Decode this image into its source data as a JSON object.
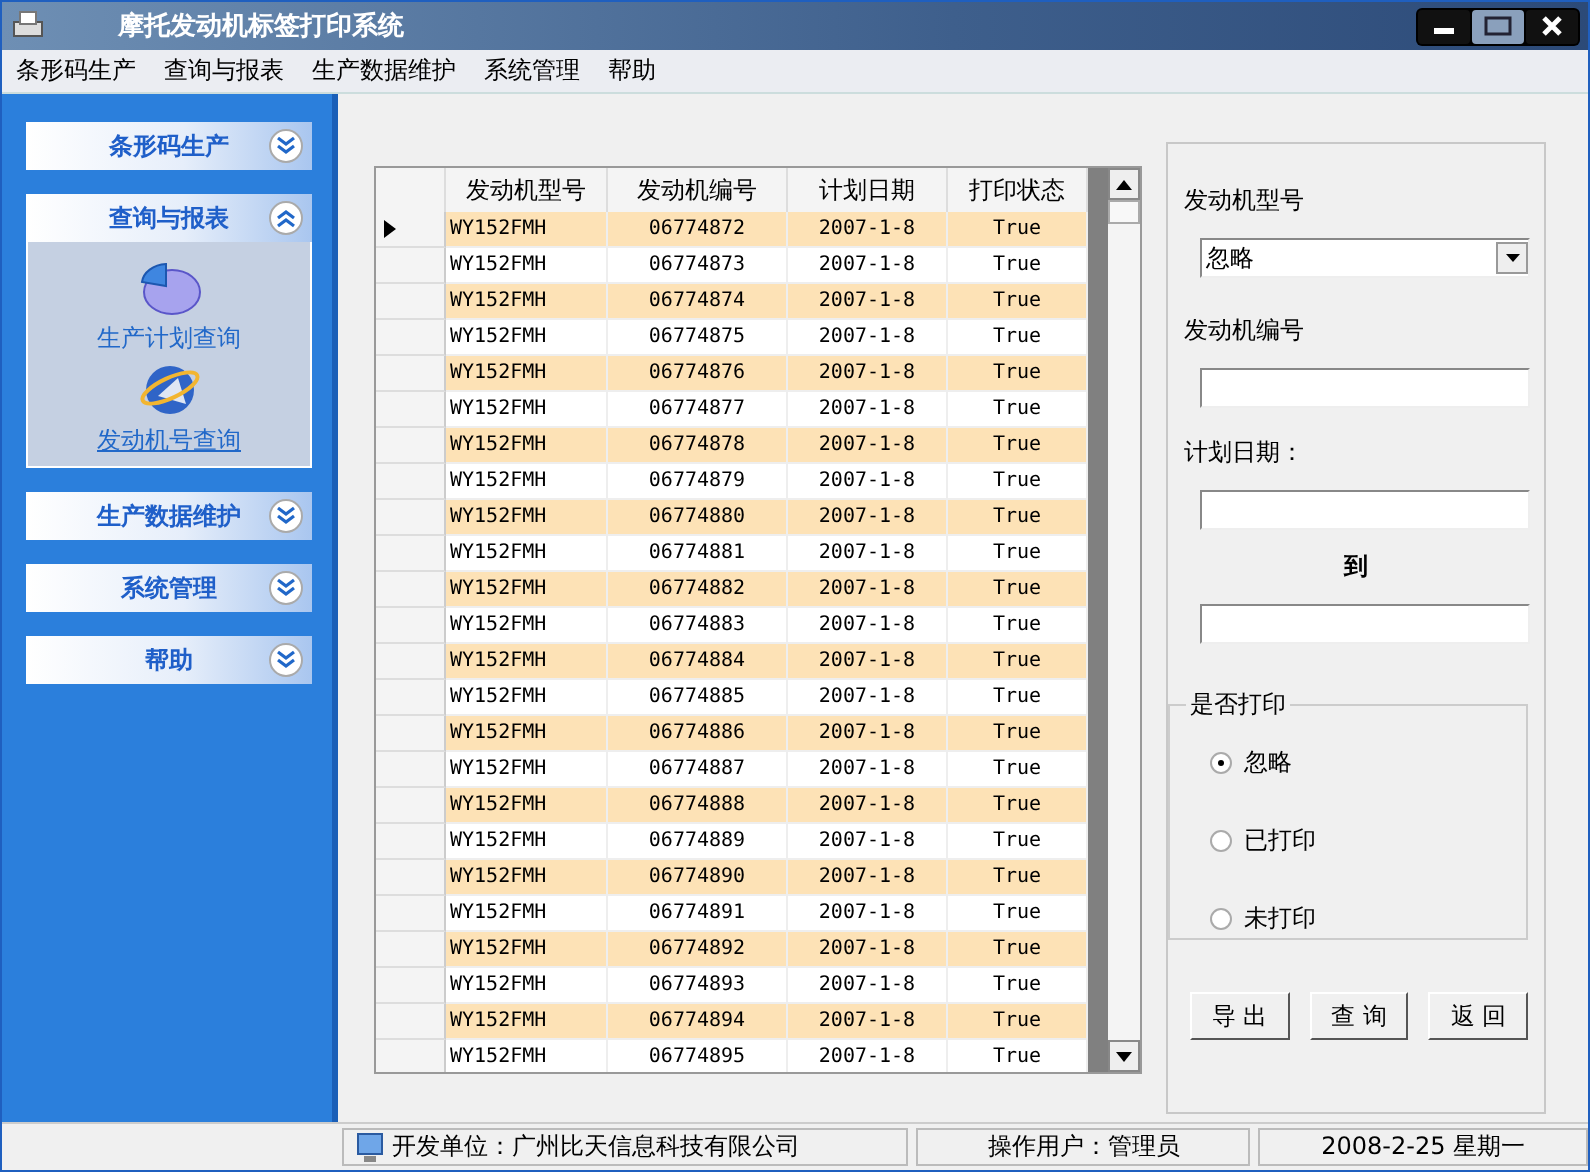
{
  "window": {
    "title": "摩托发动机标签打印系统"
  },
  "menu": [
    "条形码生产",
    "查询与报表",
    "生产数据维护",
    "系统管理",
    "帮助"
  ],
  "sidebar": {
    "groups": [
      {
        "label": "条形码生产",
        "expanded": false
      },
      {
        "label": "查询与报表",
        "expanded": true,
        "items": [
          {
            "label": "生产计划查询",
            "kind": "chart",
            "selected": false
          },
          {
            "label": "发动机号查询",
            "kind": "globe",
            "selected": true
          }
        ]
      },
      {
        "label": "生产数据维护",
        "expanded": false
      },
      {
        "label": "系统管理",
        "expanded": false
      },
      {
        "label": "帮助",
        "expanded": false
      }
    ]
  },
  "table": {
    "columns": [
      "发动机型号",
      "发动机编号",
      "计划日期",
      "打印状态"
    ],
    "rows": [
      {
        "cells": [
          "WY152FMH",
          "06774872",
          "2007-1-8",
          "True"
        ],
        "selected": true
      },
      {
        "cells": [
          "WY152FMH",
          "06774873",
          "2007-1-8",
          "True"
        ],
        "selected": false
      },
      {
        "cells": [
          "WY152FMH",
          "06774874",
          "2007-1-8",
          "True"
        ],
        "selected": false
      },
      {
        "cells": [
          "WY152FMH",
          "06774875",
          "2007-1-8",
          "True"
        ],
        "selected": false
      },
      {
        "cells": [
          "WY152FMH",
          "06774876",
          "2007-1-8",
          "True"
        ],
        "selected": false
      },
      {
        "cells": [
          "WY152FMH",
          "06774877",
          "2007-1-8",
          "True"
        ],
        "selected": false
      },
      {
        "cells": [
          "WY152FMH",
          "06774878",
          "2007-1-8",
          "True"
        ],
        "selected": false
      },
      {
        "cells": [
          "WY152FMH",
          "06774879",
          "2007-1-8",
          "True"
        ],
        "selected": false
      },
      {
        "cells": [
          "WY152FMH",
          "06774880",
          "2007-1-8",
          "True"
        ],
        "selected": false
      },
      {
        "cells": [
          "WY152FMH",
          "06774881",
          "2007-1-8",
          "True"
        ],
        "selected": false
      },
      {
        "cells": [
          "WY152FMH",
          "06774882",
          "2007-1-8",
          "True"
        ],
        "selected": false
      },
      {
        "cells": [
          "WY152FMH",
          "06774883",
          "2007-1-8",
          "True"
        ],
        "selected": false
      },
      {
        "cells": [
          "WY152FMH",
          "06774884",
          "2007-1-8",
          "True"
        ],
        "selected": false
      },
      {
        "cells": [
          "WY152FMH",
          "06774885",
          "2007-1-8",
          "True"
        ],
        "selected": false
      },
      {
        "cells": [
          "WY152FMH",
          "06774886",
          "2007-1-8",
          "True"
        ],
        "selected": false
      },
      {
        "cells": [
          "WY152FMH",
          "06774887",
          "2007-1-8",
          "True"
        ],
        "selected": false
      },
      {
        "cells": [
          "WY152FMH",
          "06774888",
          "2007-1-8",
          "True"
        ],
        "selected": false
      },
      {
        "cells": [
          "WY152FMH",
          "06774889",
          "2007-1-8",
          "True"
        ],
        "selected": false
      },
      {
        "cells": [
          "WY152FMH",
          "06774890",
          "2007-1-8",
          "True"
        ],
        "selected": false
      },
      {
        "cells": [
          "WY152FMH",
          "06774891",
          "2007-1-8",
          "True"
        ],
        "selected": false
      },
      {
        "cells": [
          "WY152FMH",
          "06774892",
          "2007-1-8",
          "True"
        ],
        "selected": false
      },
      {
        "cells": [
          "WY152FMH",
          "06774893",
          "2007-1-8",
          "True"
        ],
        "selected": false
      },
      {
        "cells": [
          "WY152FMH",
          "06774894",
          "2007-1-8",
          "True"
        ],
        "selected": false
      },
      {
        "cells": [
          "WY152FMH",
          "06774895",
          "2007-1-8",
          "True"
        ],
        "selected": false
      }
    ]
  },
  "filters": {
    "model_label": "发动机型号",
    "model_value": "忽略",
    "number_label": "发动机编号",
    "date_label": "计划日期：",
    "date_to_label": "到",
    "print_group": {
      "title": "是否打印",
      "options": [
        {
          "label": "忽略",
          "selected": true
        },
        {
          "label": "已打印",
          "selected": false
        },
        {
          "label": "未打印",
          "selected": false
        }
      ]
    },
    "buttons": [
      "导 出",
      "查 询",
      "返 回"
    ]
  },
  "status_bar": [
    "开发单位：广州比天信息科技有限公司",
    "操作用户：管理员",
    "2008-2-25  星期一"
  ]
}
